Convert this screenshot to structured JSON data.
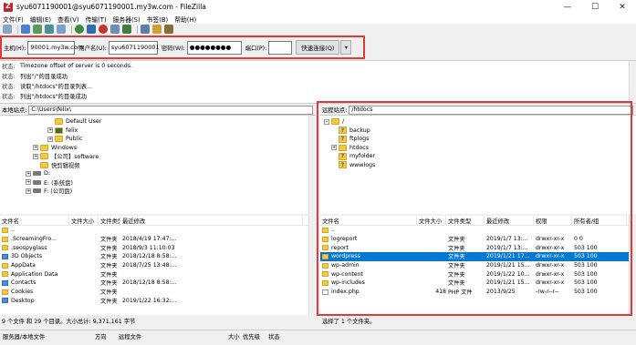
{
  "window": {
    "title": "syu6071190001@syu6071190001.my3w.com - FileZilla",
    "controls": [
      "—",
      "☐",
      "✕"
    ]
  },
  "menu": [
    "文件(F)",
    "编辑(E)",
    "查看(V)",
    "传输(T)",
    "服务器(S)",
    "书签(B)",
    "帮助(H)"
  ],
  "quickconnect": {
    "host_label": "主机(H):",
    "host_value": "90001.my3w.com",
    "user_label": "用户名(U):",
    "user_value": "syu6071190001",
    "pass_label": "密码(W):",
    "pass_value": "●●●●●●●●",
    "port_label": "端口(P):",
    "port_value": "",
    "button": "快速连接(Q)",
    "dropdown": "▾"
  },
  "log": [
    {
      "label": "状态:",
      "text": "Timezone offset of server is 0 seconds."
    },
    {
      "label": "状态:",
      "text": "列出\"/\"的目录成功"
    },
    {
      "label": "状态:",
      "text": "读取\"/htdocs\"的目录列表..."
    },
    {
      "label": "状态:",
      "text": "列出\"/htdocs\"的目录成功"
    }
  ],
  "local": {
    "site_label": "本地站点:",
    "path": "C:\\Users\\felix\\",
    "tree": [
      {
        "name": "Default User",
        "icon": "folder",
        "indent": 60,
        "exp": ""
      },
      {
        "name": "felix",
        "icon": "user",
        "indent": 52,
        "exp": "+"
      },
      {
        "name": "Public",
        "icon": "folder",
        "indent": 52,
        "exp": "+"
      },
      {
        "name": "Windows",
        "icon": "folder",
        "indent": 36,
        "exp": "+"
      },
      {
        "name": "【公司】software",
        "icon": "folder",
        "indent": 36,
        "exp": "+"
      },
      {
        "name": "快剪辑视频",
        "icon": "folder",
        "indent": 44,
        "exp": ""
      },
      {
        "name": "D:",
        "icon": "drive",
        "indent": 28,
        "exp": "+"
      },
      {
        "name": "E: (系统盘)",
        "icon": "drive",
        "indent": 28,
        "exp": "+"
      },
      {
        "name": "F: (公司盘)",
        "icon": "drive",
        "indent": 28,
        "exp": "+"
      }
    ],
    "columns": [
      "文件名",
      "文件大小",
      "文件类型",
      "最近修改"
    ],
    "files": [
      {
        "name": "..",
        "size": "",
        "type": "",
        "modified": "",
        "icon": "folder"
      },
      {
        "name": ".ScreamingFro...",
        "size": "",
        "type": "文件夹",
        "modified": "2018/4/19 17:47:...",
        "icon": "folder"
      },
      {
        "name": ".seospyglass",
        "size": "",
        "type": "文件夹",
        "modified": "2018/9/3 11:10:03",
        "icon": "folder"
      },
      {
        "name": "3D Objects",
        "size": "",
        "type": "文件夹",
        "modified": "2018/12/18 8:58:...",
        "icon": "blue"
      },
      {
        "name": "AppData",
        "size": "",
        "type": "文件夹",
        "modified": "2018/7/25 13:48:...",
        "icon": "folder"
      },
      {
        "name": "Application Data",
        "size": "",
        "type": "文件夹",
        "modified": "",
        "icon": "folder"
      },
      {
        "name": "Contacts",
        "size": "",
        "type": "文件夹",
        "modified": "2018/12/18 8:58:...",
        "icon": "blue"
      },
      {
        "name": "Cookies",
        "size": "",
        "type": "文件夹",
        "modified": "",
        "icon": "folder"
      },
      {
        "name": "Desktop",
        "size": "",
        "type": "文件夹",
        "modified": "2019/1/22 16:32:...",
        "icon": "blue"
      }
    ],
    "status": "9 个文件 和 29 个目录。大小总计: 9,371,161 字节"
  },
  "remote": {
    "site_label": "远程站点:",
    "path": "/htdocs",
    "tree": [
      {
        "name": "/",
        "icon": "folder",
        "indent": 4,
        "exp": "−"
      },
      {
        "name": "backup",
        "icon": "q",
        "indent": 20,
        "exp": ""
      },
      {
        "name": "ftplogs",
        "icon": "q",
        "indent": 20,
        "exp": ""
      },
      {
        "name": "htdocs",
        "icon": "folder",
        "indent": 12,
        "exp": "+"
      },
      {
        "name": "myfolder",
        "icon": "q",
        "indent": 20,
        "exp": ""
      },
      {
        "name": "wwwlogs",
        "icon": "q",
        "indent": 20,
        "exp": ""
      }
    ],
    "columns": [
      "文件名",
      "文件大小",
      "文件类型",
      "最近修改",
      "权限",
      "所有者/组"
    ],
    "files": [
      {
        "name": "..",
        "size": "",
        "type": "",
        "modified": "",
        "perm": "",
        "owner": "",
        "icon": "folder",
        "sel": false
      },
      {
        "name": "logreport",
        "size": "",
        "type": "文件夹",
        "modified": "2019/1/7 13:...",
        "perm": "drwxr-xr-x",
        "owner": "0 0",
        "icon": "folder",
        "sel": false
      },
      {
        "name": "report",
        "size": "",
        "type": "文件夹",
        "modified": "2019/1/7 13:...",
        "perm": "drwxr-xr-x",
        "owner": "503 100",
        "icon": "folder",
        "sel": false
      },
      {
        "name": "wordpress",
        "size": "",
        "type": "文件夹",
        "modified": "2019/1/21 17...",
        "perm": "drwxr-xr-x",
        "owner": "503 100",
        "icon": "folder",
        "sel": true
      },
      {
        "name": "wp-admin",
        "size": "",
        "type": "文件夹",
        "modified": "2019/1/21 15...",
        "perm": "drwxr-xr-x",
        "owner": "503 100",
        "icon": "folder",
        "sel": false
      },
      {
        "name": "wp-content",
        "size": "",
        "type": "文件夹",
        "modified": "2019/1/22 10...",
        "perm": "drwxr-xr-x",
        "owner": "503 100",
        "icon": "folder",
        "sel": false
      },
      {
        "name": "wp-includes",
        "size": "",
        "type": "文件夹",
        "modified": "2019/1/21 15...",
        "perm": "drwxr-xr-x",
        "owner": "503 100",
        "icon": "folder",
        "sel": false
      },
      {
        "name": "index.php",
        "size": "418",
        "type": "PHP 文件",
        "modified": "2013/9/25",
        "perm": "-rw-r--r--",
        "owner": "503 100",
        "icon": "doc",
        "sel": false
      }
    ],
    "status": "选择了 1 个文件夹。"
  },
  "queue": {
    "columns": [
      "服务器/本地文件",
      "方向",
      "远程文件",
      "大小",
      "优先级",
      "状态"
    ]
  }
}
